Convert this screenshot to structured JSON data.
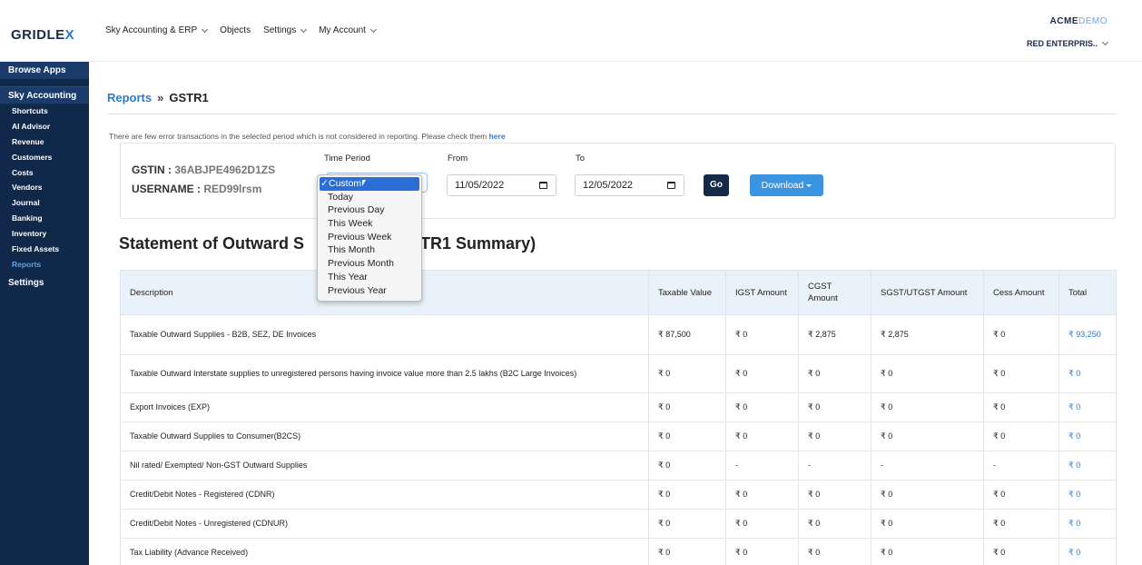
{
  "header": {
    "logo": "GRIDLE",
    "logo_x": "X",
    "nav": [
      {
        "label": "Sky Accounting & ERP",
        "dropdown": true
      },
      {
        "label": "Objects",
        "dropdown": false
      },
      {
        "label": "Settings",
        "dropdown": true
      },
      {
        "label": "My Account",
        "dropdown": true
      }
    ],
    "brand_bold": "ACME",
    "brand_light": "DEMO",
    "org": "RED ENTERPRIS.."
  },
  "sidebar": {
    "browse_apps": "Browse Apps",
    "sky_accounting": "Sky Accounting",
    "items": [
      "Shortcuts",
      "AI Advisor",
      "Revenue",
      "Customers",
      "Costs",
      "Vendors",
      "Journal",
      "Banking",
      "Inventory",
      "Fixed Assets",
      "Reports"
    ],
    "active": "Reports",
    "settings": "Settings"
  },
  "breadcrumb": {
    "link": "Reports",
    "sep": "»",
    "current": "GSTR1"
  },
  "notice": {
    "text": "There are few error transactions in the selected period which is not considered in reporting. Please check them ",
    "link": "here"
  },
  "filters": {
    "gstin_label": "GSTIN :",
    "gstin_value": "36ABJPE4962D1ZS",
    "username_label": "USERNAME :",
    "username_value": "RED99lrsm",
    "time_period_label": "Time Period",
    "from_label": "From",
    "from_value": "11/05/2022",
    "to_label": "To",
    "to_value": "12/05/2022",
    "go_label": "Go",
    "download_label": "Download"
  },
  "dropdown": {
    "selected": "Custom",
    "options": [
      "Custom",
      "Today",
      "Previous Day",
      "This Week",
      "Previous Week",
      "This Month",
      "Previous Month",
      "This Year",
      "Previous Year"
    ]
  },
  "heading": {
    "left": "Statement of Outward S",
    "right": "TR1 Summary)"
  },
  "table": {
    "columns": [
      "Description",
      "Taxable Value",
      "IGST Amount",
      "CGST Amount",
      "SGST/UTGST Amount",
      "Cess Amount",
      "Total"
    ],
    "rows": [
      [
        "Taxable Outward Supplies - B2B, SEZ, DE Invoices",
        "₹ 87,500",
        "₹ 0",
        "₹ 2,875",
        "₹ 2,875",
        "₹ 0",
        "₹ 93,250"
      ],
      [
        "Taxable Outward Interstate supplies to unregistered persons having invoice value more than 2.5 lakhs (B2C Large Invoices)",
        "₹ 0",
        "₹ 0",
        "₹ 0",
        "₹ 0",
        "₹ 0",
        "₹ 0"
      ],
      [
        "Export Invoices (EXP)",
        "₹ 0",
        "₹ 0",
        "₹ 0",
        "₹ 0",
        "₹ 0",
        "₹ 0"
      ],
      [
        "Taxable Outward Supplies to Consumer(B2CS)",
        "₹ 0",
        "₹ 0",
        "₹ 0",
        "₹ 0",
        "₹ 0",
        "₹ 0"
      ],
      [
        "Nil rated/ Exempted/ Non-GST Outward Supplies",
        "₹ 0",
        "-",
        "-",
        "-",
        "-",
        "₹ 0"
      ],
      [
        "Credit/Debit Notes - Registered (CDNR)",
        "₹ 0",
        "₹ 0",
        "₹ 0",
        "₹ 0",
        "₹ 0",
        "₹ 0"
      ],
      [
        "Credit/Debit Notes - Unregistered (CDNUR)",
        "₹ 0",
        "₹ 0",
        "₹ 0",
        "₹ 0",
        "₹ 0",
        "₹ 0"
      ],
      [
        "Tax Liability (Advance Received)",
        "₹ 0",
        "₹ 0",
        "₹ 0",
        "₹ 0",
        "₹ 0",
        "₹ 0"
      ]
    ]
  },
  "colors": {
    "sidebar_bg": "#10284a",
    "accent": "#2a7bd0",
    "go_btn": "#142a48",
    "download_btn": "#3b94e0"
  }
}
